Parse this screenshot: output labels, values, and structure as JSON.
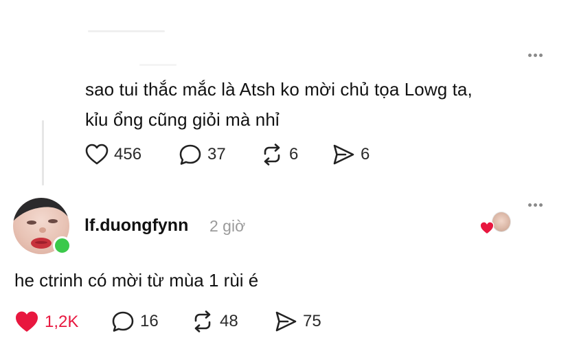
{
  "post": {
    "text_line1": "sao tui thắc mắc là Atsh ko mời chủ tọa Lowg ta,",
    "text_line2": "kỉu ổng cũng giỏi mà nhỉ",
    "likes": "456",
    "comments": "37",
    "reposts": "6",
    "shares": "6",
    "more_icon": "more-horizontal-icon"
  },
  "reply": {
    "username": "lf.duongfynn",
    "time": "2 giờ",
    "text": "he ctrinh có mời từ mùa 1 rùi é",
    "likes": "1,2K",
    "comments": "16",
    "reposts": "48",
    "shares": "75",
    "liked_by_author": true,
    "online": true
  },
  "colors": {
    "like_active": "#e8173f",
    "online": "#3bc94b",
    "text_secondary": "#9a9a9a"
  }
}
